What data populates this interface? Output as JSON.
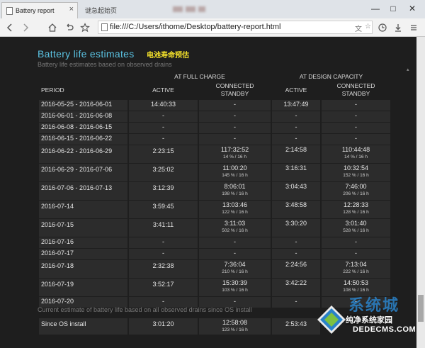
{
  "browser": {
    "active_tab_title": "Battery report",
    "inactive_tab_title": "谜急起始页",
    "tab_close_glyph": "×",
    "url": "file:///C:/Users/ithome/Desktop/battery-report.html",
    "window_controls": [
      "—",
      "□",
      "✕"
    ]
  },
  "report": {
    "section_title": "Battery life estimates",
    "annotation": "电池寿命预估",
    "subtitle": "Battery life estimates based on observed drains",
    "headers": {
      "group_full": "AT FULL CHARGE",
      "group_design": "AT DESIGN CAPACITY",
      "period": "PERIOD",
      "active": "ACTIVE",
      "connected_standby_1": "CONNECTED",
      "connected_standby_2": "STANDBY"
    },
    "rows": [
      {
        "period": "2016-05-25 - 2016-06-01",
        "full_active": "14:40:33",
        "full_standby": "-",
        "full_standby_sub": "",
        "design_active": "13:47:49",
        "design_standby": "-",
        "design_standby_sub": ""
      },
      {
        "period": "2016-06-01 - 2016-06-08",
        "full_active": "-",
        "full_standby": "-",
        "full_standby_sub": "",
        "design_active": "-",
        "design_standby": "-",
        "design_standby_sub": ""
      },
      {
        "period": "2016-06-08 - 2016-06-15",
        "full_active": "-",
        "full_standby": "-",
        "full_standby_sub": "",
        "design_active": "-",
        "design_standby": "-",
        "design_standby_sub": ""
      },
      {
        "period": "2016-06-15 - 2016-06-22",
        "full_active": "-",
        "full_standby": "-",
        "full_standby_sub": "",
        "design_active": "-",
        "design_standby": "-",
        "design_standby_sub": ""
      },
      {
        "period": "2016-06-22 - 2016-06-29",
        "full_active": "2:23:15",
        "full_standby": "117:32:52",
        "full_standby_sub": "14 % / 16 h",
        "design_active": "2:14:58",
        "design_standby": "110:44:48",
        "design_standby_sub": "14 % / 16 h"
      },
      {
        "period": "2016-06-29 - 2016-07-06",
        "full_active": "3:25:02",
        "full_standby": "11:00:20",
        "full_standby_sub": "145 % / 16 h",
        "design_active": "3:16:31",
        "design_standby": "10:32:54",
        "design_standby_sub": "152 % / 16 h"
      },
      {
        "period": "2016-07-06 - 2016-07-13",
        "full_active": "3:12:39",
        "full_standby": "8:06:01",
        "full_standby_sub": "198 % / 16 h",
        "design_active": "3:04:43",
        "design_standby": "7:46:00",
        "design_standby_sub": "206 % / 16 h"
      },
      {
        "period": "2016-07-14",
        "full_active": "3:59:45",
        "full_standby": "13:03:46",
        "full_standby_sub": "122 % / 16 h",
        "design_active": "3:48:58",
        "design_standby": "12:28:33",
        "design_standby_sub": "128 % / 16 h"
      },
      {
        "period": "2016-07-15",
        "full_active": "3:41:11",
        "full_standby": "3:11:03",
        "full_standby_sub": "502 % / 16 h",
        "design_active": "3:30:20",
        "design_standby": "3:01:40",
        "design_standby_sub": "528 % / 16 h"
      },
      {
        "period": "2016-07-16",
        "full_active": "-",
        "full_standby": "-",
        "full_standby_sub": "",
        "design_active": "-",
        "design_standby": "-",
        "design_standby_sub": ""
      },
      {
        "period": "2016-07-17",
        "full_active": "-",
        "full_standby": "-",
        "full_standby_sub": "",
        "design_active": "-",
        "design_standby": "-",
        "design_standby_sub": ""
      },
      {
        "period": "2016-07-18",
        "full_active": "2:32:38",
        "full_standby": "7:36:04",
        "full_standby_sub": "210 % / 16 h",
        "design_active": "2:24:56",
        "design_standby": "7:13:04",
        "design_standby_sub": "222 % / 16 h"
      },
      {
        "period": "2016-07-19",
        "full_active": "3:52:17",
        "full_standby": "15:30:39",
        "full_standby_sub": "103 % / 16 h",
        "design_active": "3:42:22",
        "design_standby": "14:50:53",
        "design_standby_sub": "108 % / 16 h"
      },
      {
        "period": "2016-07-20",
        "full_active": "-",
        "full_standby": "-",
        "full_standby_sub": "",
        "design_active": "-",
        "design_standby": "-",
        "design_standby_sub": ""
      }
    ],
    "current_estimate_caption": "Current estimate of battery life based on all observed drains since OS install",
    "current_estimate": {
      "period": "Since OS install",
      "full_active": "3:01:20",
      "full_standby": "12:58:08",
      "full_standby_sub": "123 % / 16 h",
      "design_active": "2:53:43"
    }
  },
  "watermark": {
    "brand": "系统城",
    "sub": "纯净系统家园",
    "url": "DEDECMS.COM"
  },
  "colors": {
    "title": "#5bc3e3",
    "annotation": "#f3e02b",
    "cell_bg": "#2c2c2c",
    "page_bg": "#1e1e1e"
  }
}
